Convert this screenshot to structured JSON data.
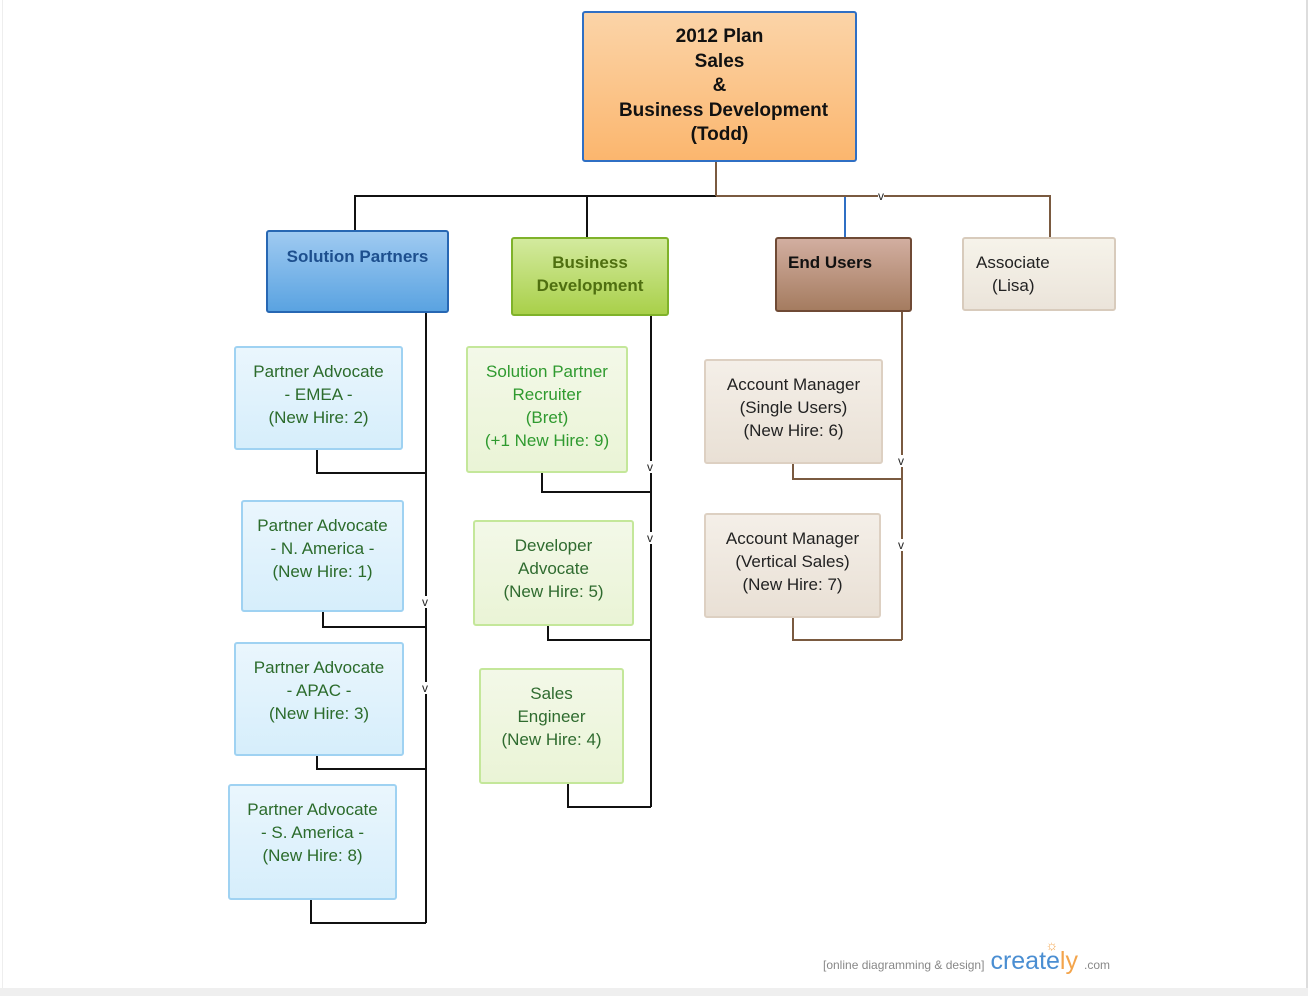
{
  "root": {
    "lines": [
      "2012 Plan",
      "Sales",
      "&",
      "Business Development",
      "(Todd)"
    ]
  },
  "departments": [
    {
      "id": "solution-partners",
      "lines": [
        "Solution Partners"
      ],
      "color": "#5aa3e1"
    },
    {
      "id": "business-development",
      "lines": [
        "Business",
        "Development"
      ],
      "color": "#a9d04a"
    },
    {
      "id": "end-users",
      "lines": [
        "End Users"
      ],
      "color": "#a57c60"
    },
    {
      "id": "associate",
      "lines": [
        "Associate",
        "(Lisa)"
      ],
      "color": "#ebe4da"
    }
  ],
  "solution_partners_children": [
    {
      "lines": [
        "Partner Advocate",
        "- EMEA -",
        "(New Hire: 2)"
      ]
    },
    {
      "lines": [
        "Partner Advocate",
        "- N. America -",
        "(New Hire: 1)"
      ]
    },
    {
      "lines": [
        "Partner Advocate",
        "- APAC -",
        "(New Hire: 3)"
      ]
    },
    {
      "lines": [
        "Partner Advocate",
        "- S. America -",
        "(New Hire: 8)"
      ]
    }
  ],
  "business_development_children": [
    {
      "lines": [
        "Solution Partner",
        "Recruiter",
        "(Bret)",
        "(+1 New Hire: 9)"
      ]
    },
    {
      "lines": [
        "Developer",
        "Advocate",
        "(New Hire: 5)"
      ]
    },
    {
      "lines": [
        "Sales",
        "Engineer",
        "(New Hire: 4)"
      ]
    }
  ],
  "end_users_children": [
    {
      "lines": [
        "Account Manager",
        "(Single Users)",
        "(New Hire: 6)"
      ]
    },
    {
      "lines": [
        "Account Manager",
        "(Vertical Sales)",
        "(New Hire: 7)"
      ]
    }
  ],
  "connector_mark": "v",
  "footer": {
    "tagline": "[online diagramming & design]",
    "logo_main": "create",
    "logo_accent": "ly",
    "logo_suffix": ".com"
  }
}
